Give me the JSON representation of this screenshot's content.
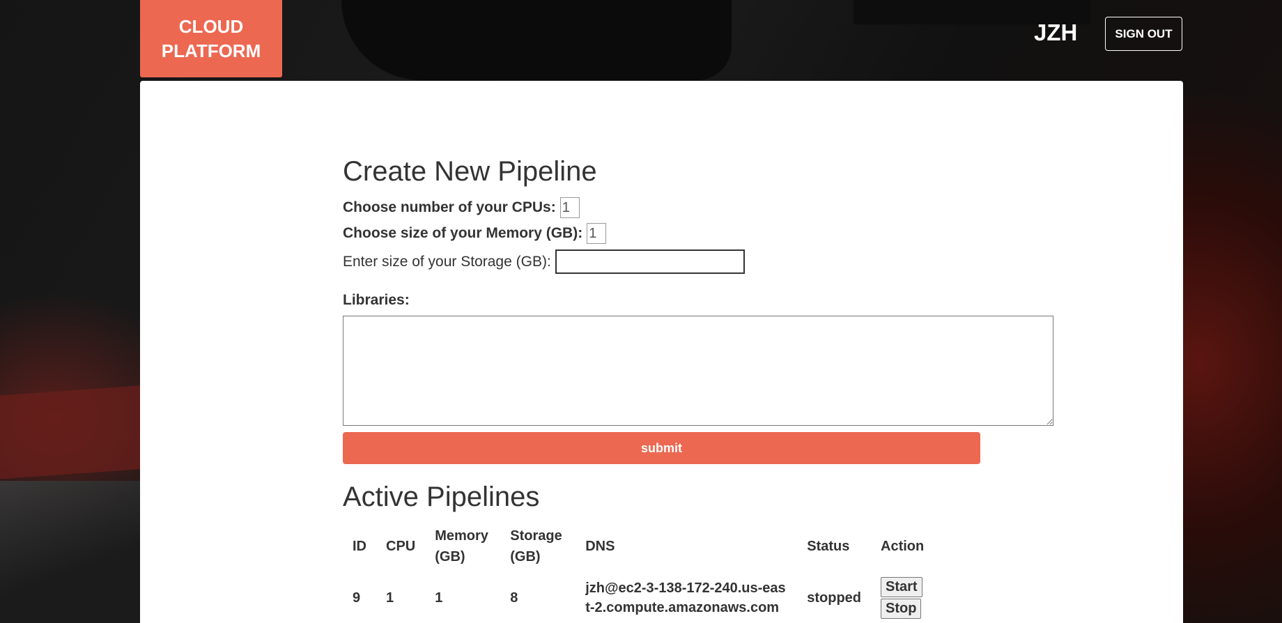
{
  "header": {
    "logo_line1": "CLOUD",
    "logo_line2": "PLATFORM",
    "user": "JZH",
    "signout_label": "SIGN OUT"
  },
  "create": {
    "title": "Create New Pipeline",
    "cpu_label": "Choose number of your CPUs:",
    "cpu_value": "1",
    "memory_label": "Choose size of your Memory (GB):",
    "memory_value": "1",
    "storage_label": "Enter size of your Storage (GB):",
    "storage_value": "",
    "libraries_label": "Libraries:",
    "libraries_value": "",
    "submit_label": "submit"
  },
  "active": {
    "title": "Active Pipelines",
    "columns": {
      "id": "ID",
      "cpu": "CPU",
      "memory": "Memory (GB)",
      "storage": "Storage (GB)",
      "dns": "DNS",
      "status": "Status",
      "action": "Action"
    },
    "rows": [
      {
        "id": "9",
        "cpu": "1",
        "memory": "1",
        "storage": "8",
        "dns": "jzh@ec2-3-138-172-240.us-east-2.compute.amazonaws.com",
        "status": "stopped",
        "start_label": "Start",
        "stop_label": "Stop"
      }
    ]
  }
}
